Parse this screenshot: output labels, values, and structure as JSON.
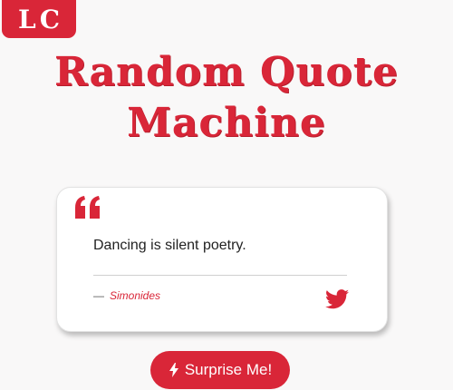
{
  "logo": {
    "text": "LC"
  },
  "header": {
    "title_line1": "Random Quote",
    "title_line2": "Machine"
  },
  "quote": {
    "icon": "quote-left-icon",
    "text": "Dancing is silent poetry.",
    "dash": "—",
    "author": "Simonides"
  },
  "actions": {
    "tweet_icon": "twitter-icon",
    "surprise_label": "Surprise Me!",
    "surprise_icon": "bolt-icon"
  },
  "colors": {
    "accent": "#d92638",
    "background": "#f9f8f8",
    "card": "#ffffff"
  }
}
